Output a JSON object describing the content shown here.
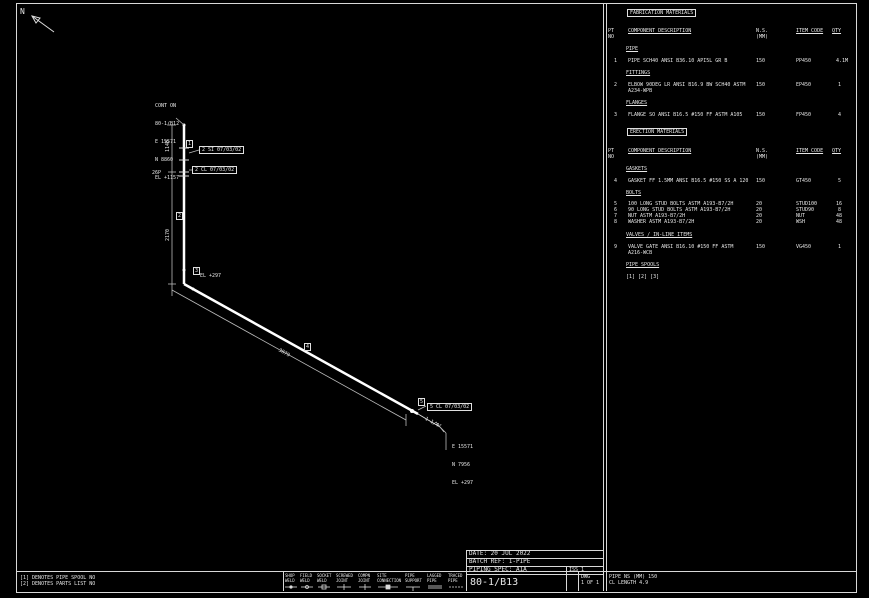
{
  "north": "N",
  "iso": {
    "top_labels": [
      "CONT ON",
      "80-1/B12",
      "E 15571",
      "N 8860",
      "EL +1157"
    ],
    "dim_vertical_1": "1140",
    "dim_vertical_2": "2170",
    "dim_horizontal": "3879",
    "flag_1": "2 SI 07/03/02",
    "flag_2": "2 CL 07/03/02",
    "flag_3": "5 CL 07/03/02",
    "label_26p": "26P",
    "marker_1": "1",
    "marker_2": "2",
    "marker_3": "3",
    "marker_4": "4",
    "marker_5": "5",
    "bend_el": "EL +297",
    "end_labels": [
      "E 15571",
      "N 7956",
      "EL +297"
    ],
    "end_tag": "1-1/4\""
  },
  "bom": {
    "fab_title": "FABRICATION MATERIALS",
    "erect_title": "ERECTION MATERIALS",
    "col_pt": "PT",
    "col_no": "NO",
    "col_desc": "COMPONENT DESCRIPTION",
    "col_ns": "N.S.",
    "col_ns2": "(MM)",
    "col_code": "ITEM CODE",
    "col_qty": "QTY",
    "fab_groups": [
      {
        "title": "PIPE",
        "items": [
          {
            "pt": "1",
            "desc": "PIPE SCH40 ANSI B36.10 API5L GR B",
            "ns": "150",
            "code": "PP450",
            "qty": "4.1M"
          }
        ]
      },
      {
        "title": "FITTINGS",
        "items": [
          {
            "pt": "2",
            "desc": "ELBOW 90DEG LR ANSI B16.9 BW SCH40 ASTM\nA234-WPB",
            "ns": "150",
            "code": "EP450",
            "qty": "1"
          }
        ]
      },
      {
        "title": "FLANGES",
        "items": [
          {
            "pt": "3",
            "desc": "FLANGE SO ANSI B16.5 #150 FF ASTM A105",
            "ns": "150",
            "code": "FP450",
            "qty": "4"
          }
        ]
      }
    ],
    "erect_groups": [
      {
        "title": "GASKETS",
        "items": [
          {
            "pt": "4",
            "desc": "GASKET FF 1.5MM ANSI B16.5 #150 SS A 120",
            "ns": "150",
            "code": "GT450",
            "qty": "5"
          }
        ]
      },
      {
        "title": "BOLTS",
        "items": [
          {
            "pt": "5",
            "desc": "100 LONG STUD BOLTS ASTM A193-B7/2H",
            "ns": "20",
            "code": "STUD100",
            "qty": "16"
          },
          {
            "pt": "6",
            "desc": "90 LONG STUD BOLTS ASTM A193-B7/2H",
            "ns": "20",
            "code": "STUD90",
            "qty": "8"
          },
          {
            "pt": "7",
            "desc": "NUT ASTM A193-B7/2H",
            "ns": "20",
            "code": "NUT",
            "qty": "48"
          },
          {
            "pt": "8",
            "desc": "WASHER ASTM A193-B7/2H",
            "ns": "20",
            "code": "WSH",
            "qty": "48"
          }
        ]
      },
      {
        "title": "VALVES / IN-LINE ITEMS",
        "items": [
          {
            "pt": "9",
            "desc": "VALVE GATE ANSI B16.10 #150 FF ASTM\nA216-WCB",
            "ns": "150",
            "code": "VG450",
            "qty": "1"
          }
        ]
      }
    ],
    "spools_title": "PIPE SPOOLS",
    "spools": "[1] [2] [3]"
  },
  "title_block": {
    "date": "DATE: 20 JUL 2022",
    "batch": "BATCH REF: 1-PIPE",
    "spec": "PIPING SPEC: A1A",
    "drawing_no": "80-1/B13",
    "iss": "ISS",
    "iss_val": "1",
    "dwg_label": "DWG",
    "dwg_val": "1 OF 1",
    "pipe_ns": "PIPE NS (MM)  150",
    "cl_length": "CL LENGTH     4.9"
  },
  "notes": [
    "[1] DENOTES PIPE SPOOL NO",
    "[2] DENOTES PARTS LIST NO"
  ],
  "legend": [
    {
      "top": "SHOP",
      "bot": "WELD"
    },
    {
      "top": "FIELD",
      "bot": "WELD"
    },
    {
      "top": "SOCKET",
      "bot": "WELD"
    },
    {
      "top": "SCREWED",
      "bot": "JOINT"
    },
    {
      "top": "COMPN",
      "bot": "JOINT"
    },
    {
      "top": "SITE",
      "bot": "CONNECTION"
    },
    {
      "top": "PIPE",
      "bot": "SUPPORT"
    },
    {
      "top": "LAGGED",
      "bot": "PIPE"
    },
    {
      "top": "TRACED",
      "bot": "PIPE"
    }
  ]
}
